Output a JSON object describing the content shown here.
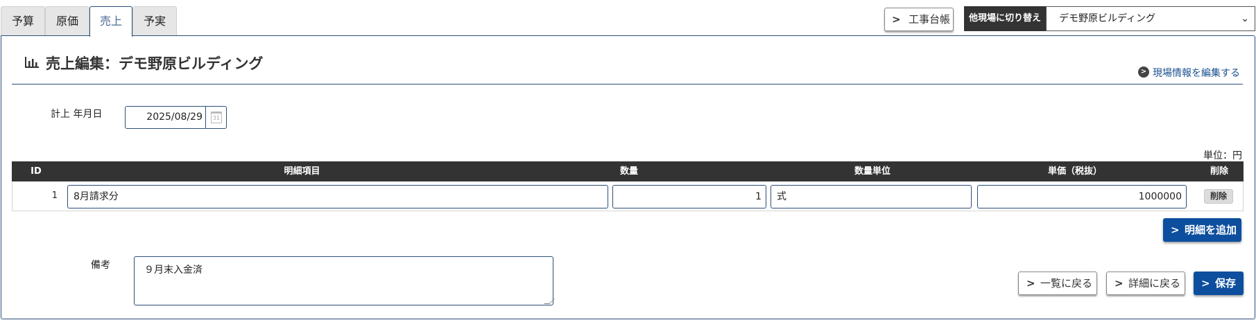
{
  "tabs": [
    {
      "label": "予算",
      "active": false
    },
    {
      "label": "原価",
      "active": false
    },
    {
      "label": "売上",
      "active": true
    },
    {
      "label": "予実",
      "active": false
    }
  ],
  "toolbar": {
    "ledger_button": "工事台帳",
    "switch_label": "他現場に切り替え",
    "site_select_value": "デモ野原ビルディング"
  },
  "page": {
    "title_icon": "bar-chart-icon",
    "title": "売上編集：デモ野原ビルディング",
    "edit_site_link": "現場情報を編集する"
  },
  "form": {
    "date_label": "計上 年月日",
    "date_value": "2025/08/29",
    "unit_note": "単位：円",
    "memo_label": "備考",
    "memo_value": "９月末入金済"
  },
  "table": {
    "headers": {
      "id": "ID",
      "item": "明細項目",
      "qty": "数量",
      "unit": "数量単位",
      "price": "単価（税抜）",
      "delete": "削除"
    },
    "rows": [
      {
        "id": "1",
        "item": "8月請求分",
        "qty": "1",
        "unit": "式",
        "price": "1000000",
        "delete": "削除"
      }
    ]
  },
  "actions": {
    "add_row": "明細を追加",
    "back_to_list": "一覧に戻る",
    "back_to_detail": "詳細に戻る",
    "save": "保存"
  },
  "colors": {
    "accent_blue": "#0d4f9e",
    "border_navy": "#2b4f78",
    "header_dark": "#333333"
  }
}
